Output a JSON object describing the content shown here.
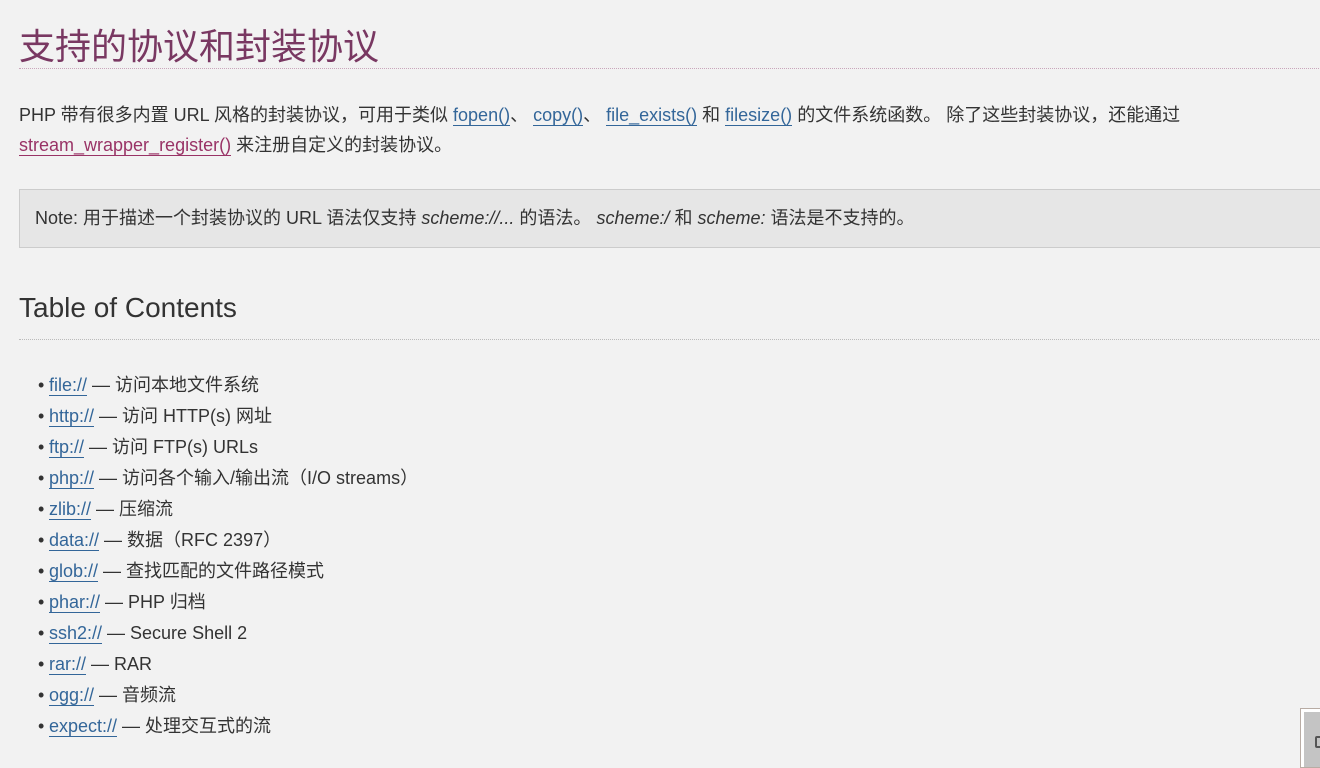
{
  "title": "支持的协议和封装协议",
  "intro": {
    "t1": "PHP 带有很多内置 URL 风格的封装协议，可用于类似 ",
    "fopen": "fopen()",
    "s1": "、 ",
    "copy": "copy()",
    "s2": "、 ",
    "file_exists": "file_exists()",
    "s3": " 和 ",
    "filesize": "filesize()",
    "t2": " 的文件系统函数。 除了这些封装协议，还能通过 ",
    "register": "stream_wrapper_register()",
    "t3": " 来注册自定义的封装协议。"
  },
  "note": {
    "label": "Note:",
    "t1": " 用于描述一个封装协议的 URL 语法仅支持 ",
    "em1": "scheme://...",
    "t2": " 的语法。 ",
    "em2": "scheme:/",
    "t3": " 和 ",
    "em3": "scheme:",
    "t4": " 语法是不支持的。"
  },
  "toc": {
    "heading": "Table of Contents",
    "items": [
      {
        "link": "file://",
        "desc": " — 访问本地文件系统"
      },
      {
        "link": "http://",
        "desc": " — 访问 HTTP(s) 网址"
      },
      {
        "link": "ftp://",
        "desc": " — 访问 FTP(s) URLs"
      },
      {
        "link": "php://",
        "desc": " — 访问各个输入/输出流（I/O streams）"
      },
      {
        "link": "zlib://",
        "desc": " — 压缩流"
      },
      {
        "link": "data://",
        "desc": " — 数据（RFC 2397）"
      },
      {
        "link": "glob://",
        "desc": " — 查找匹配的文件路径模式"
      },
      {
        "link": "phar://",
        "desc": " — PHP 归档"
      },
      {
        "link": "ssh2://",
        "desc": " — Secure Shell 2"
      },
      {
        "link": "rar://",
        "desc": " — RAR"
      },
      {
        "link": "ogg://",
        "desc": " — 音频流"
      },
      {
        "link": "expect://",
        "desc": " — 处理交互式的流"
      }
    ]
  },
  "colors": {
    "title": "#793862",
    "link": "#336699",
    "visited": "#993366"
  }
}
